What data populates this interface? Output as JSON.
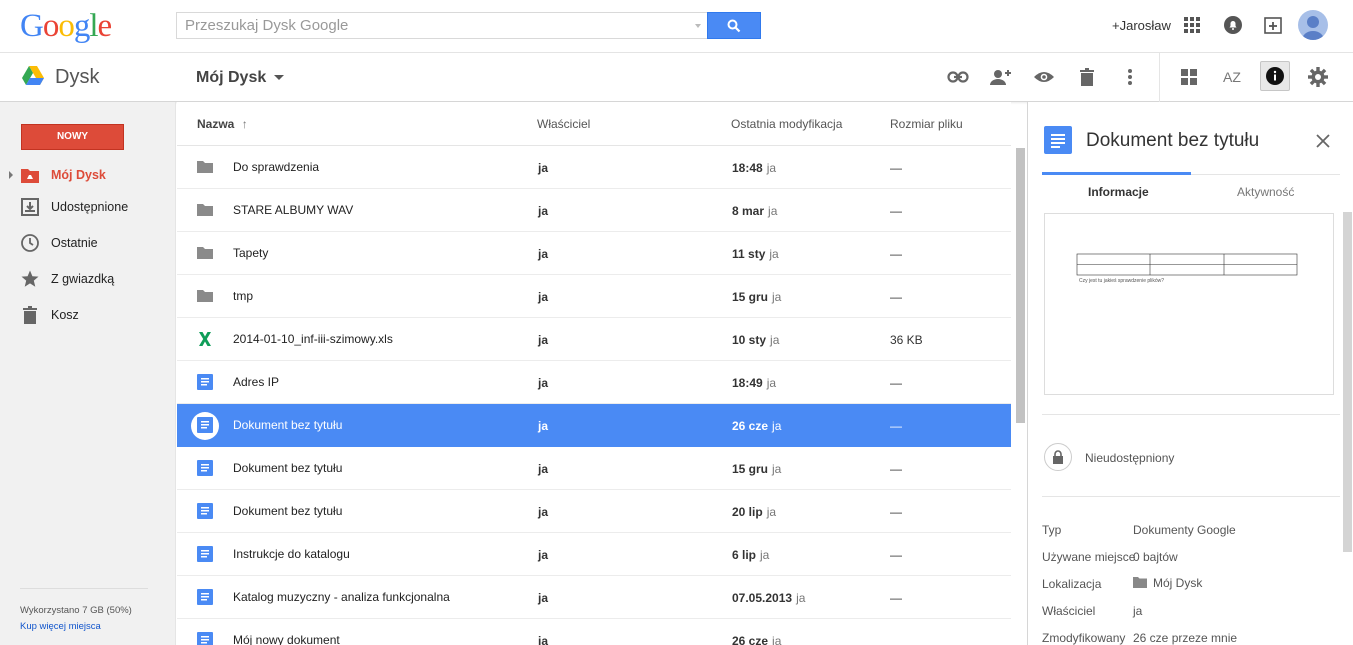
{
  "header": {
    "logo_letters": [
      "G",
      "o",
      "o",
      "g",
      "l",
      "e"
    ],
    "logo_colors": [
      "#4285f4",
      "#ea4335",
      "#fbbc05",
      "#4285f4",
      "#34a853",
      "#ea4335"
    ],
    "search_placeholder": "Przeszukaj Dysk Google",
    "search_value": "",
    "user_name": "+Jarosław",
    "icons": [
      "apps-grid-icon",
      "notifications-bell-icon",
      "share-plus-icon",
      "avatar"
    ]
  },
  "toolbar": {
    "app_name": "Dysk",
    "breadcrumb": "Mój Dysk",
    "actions": [
      "link-icon",
      "add-person-icon",
      "preview-eye-icon",
      "trash-icon",
      "more-vert-icon",
      "grid-view-icon",
      "sort-az-icon",
      "info-icon",
      "settings-gear-icon"
    ],
    "sort_az_label": "AZ"
  },
  "sidebar": {
    "new_button": "NOWY",
    "items": [
      {
        "label": "Mój Dysk",
        "icon": "drive-folder-icon",
        "active": true
      },
      {
        "label": "Udostępnione",
        "icon": "shared-icon",
        "active": false
      },
      {
        "label": "Ostatnie",
        "icon": "clock-icon",
        "active": false
      },
      {
        "label": "Z gwiazdką",
        "icon": "star-icon",
        "active": false
      },
      {
        "label": "Kosz",
        "icon": "trash-icon",
        "active": false
      }
    ],
    "quota_text": "Wykorzystano 7 GB (50%)",
    "quota_link": "Kup więcej miejsca"
  },
  "file_list": {
    "columns": {
      "name": "Nazwa",
      "owner": "Właściciel",
      "modified": "Ostatnia modyfikacja",
      "size": "Rozmiar pliku"
    },
    "sort_indicator": "↑",
    "rows": [
      {
        "type": "folder",
        "name": "Do sprawdzenia",
        "owner": "ja",
        "modified": "18:48",
        "by": "ja",
        "size": "—",
        "selected": false
      },
      {
        "type": "folder",
        "name": "STARE ALBUMY WAV",
        "owner": "ja",
        "modified": "8 mar",
        "by": "ja",
        "size": "—",
        "selected": false
      },
      {
        "type": "folder",
        "name": "Tapety",
        "owner": "ja",
        "modified": "11 sty",
        "by": "ja",
        "size": "—",
        "selected": false
      },
      {
        "type": "folder",
        "name": "tmp",
        "owner": "ja",
        "modified": "15 gru",
        "by": "ja",
        "size": "—",
        "selected": false
      },
      {
        "type": "sheet",
        "name": "2014-01-10_inf-iii-szimowy.xls",
        "owner": "ja",
        "modified": "10 sty",
        "by": "ja",
        "size": "36 KB",
        "selected": false
      },
      {
        "type": "doc",
        "name": "Adres IP",
        "owner": "ja",
        "modified": "18:49",
        "by": "ja",
        "size": "—",
        "selected": false
      },
      {
        "type": "doc",
        "name": "Dokument bez tytułu",
        "owner": "ja",
        "modified": "26 cze",
        "by": "ja",
        "size": "—",
        "selected": true
      },
      {
        "type": "doc",
        "name": "Dokument bez tytułu",
        "owner": "ja",
        "modified": "15 gru",
        "by": "ja",
        "size": "—",
        "selected": false
      },
      {
        "type": "doc",
        "name": "Dokument bez tytułu",
        "owner": "ja",
        "modified": "20 lip",
        "by": "ja",
        "size": "—",
        "selected": false
      },
      {
        "type": "doc",
        "name": "Instrukcje do katalogu",
        "owner": "ja",
        "modified": "6 lip",
        "by": "ja",
        "size": "—",
        "selected": false
      },
      {
        "type": "doc",
        "name": "Katalog muzyczny - analiza funkcjonalna",
        "owner": "ja",
        "modified": "07.05.2013",
        "by": "ja",
        "size": "—",
        "selected": false
      },
      {
        "type": "doc",
        "name": "Mój nowy dokument",
        "owner": "ja",
        "modified": "26 cze",
        "by": "ja",
        "size": "",
        "selected": false
      }
    ]
  },
  "details_panel": {
    "title": "Dokument bez tytułu",
    "tabs": [
      "Informacje",
      "Aktywność"
    ],
    "preview_caption": "Czy jest tu jakieś sprawdzenie plików?",
    "share_status": "Nieudostępniony",
    "properties": [
      {
        "label": "Typ",
        "value": "Dokumenty Google"
      },
      {
        "label": "Używane miejsce",
        "value": "0 bajtów"
      },
      {
        "label": "Lokalizacja",
        "value": "Mój Dysk"
      },
      {
        "label": "Właściciel",
        "value": "ja"
      },
      {
        "label": "Zmodyfikowany",
        "value": "26 cze przeze mnie"
      }
    ]
  },
  "colors": {
    "accent_blue": "#4a8af4",
    "new_button_red": "#dd4b39",
    "sheet_green": "#0f9d58"
  }
}
